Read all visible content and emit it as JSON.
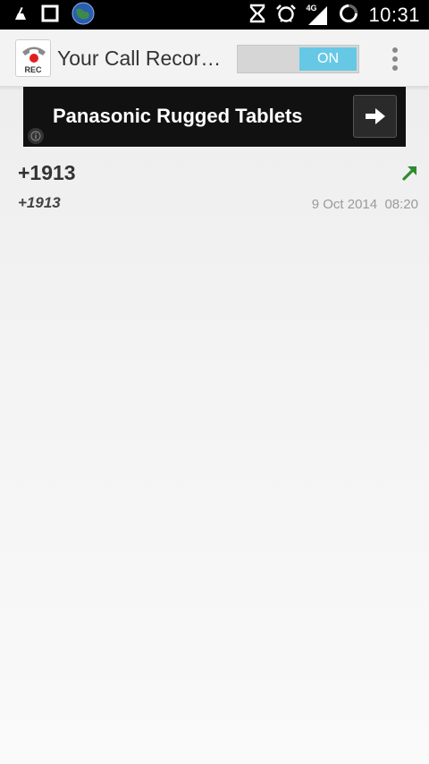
{
  "status_bar": {
    "time": "10:31",
    "network_type": "4G",
    "icons": [
      "broom-icon",
      "square-stop-icon",
      "globe-icon",
      "hourglass-icon",
      "alarm-icon",
      "signal-icon",
      "sync-circle-icon"
    ]
  },
  "action_bar": {
    "app_icon_text": "REC",
    "title": "Your Call Recor…",
    "toggle_label": "ON",
    "toggle_state": "on",
    "colors": {
      "toggle_on": "#67c8e6",
      "toggle_track": "#d6d6d6"
    }
  },
  "ad": {
    "text": "Panasonic Rugged Tablets"
  },
  "calls": [
    {
      "number": "+1913",
      "name": "+1913",
      "date": "9 Oct 2014",
      "time": "08:20",
      "datetime": "9 Oct 2014  08:20",
      "direction": "outgoing",
      "direction_color": "#2e8b2e"
    }
  ]
}
